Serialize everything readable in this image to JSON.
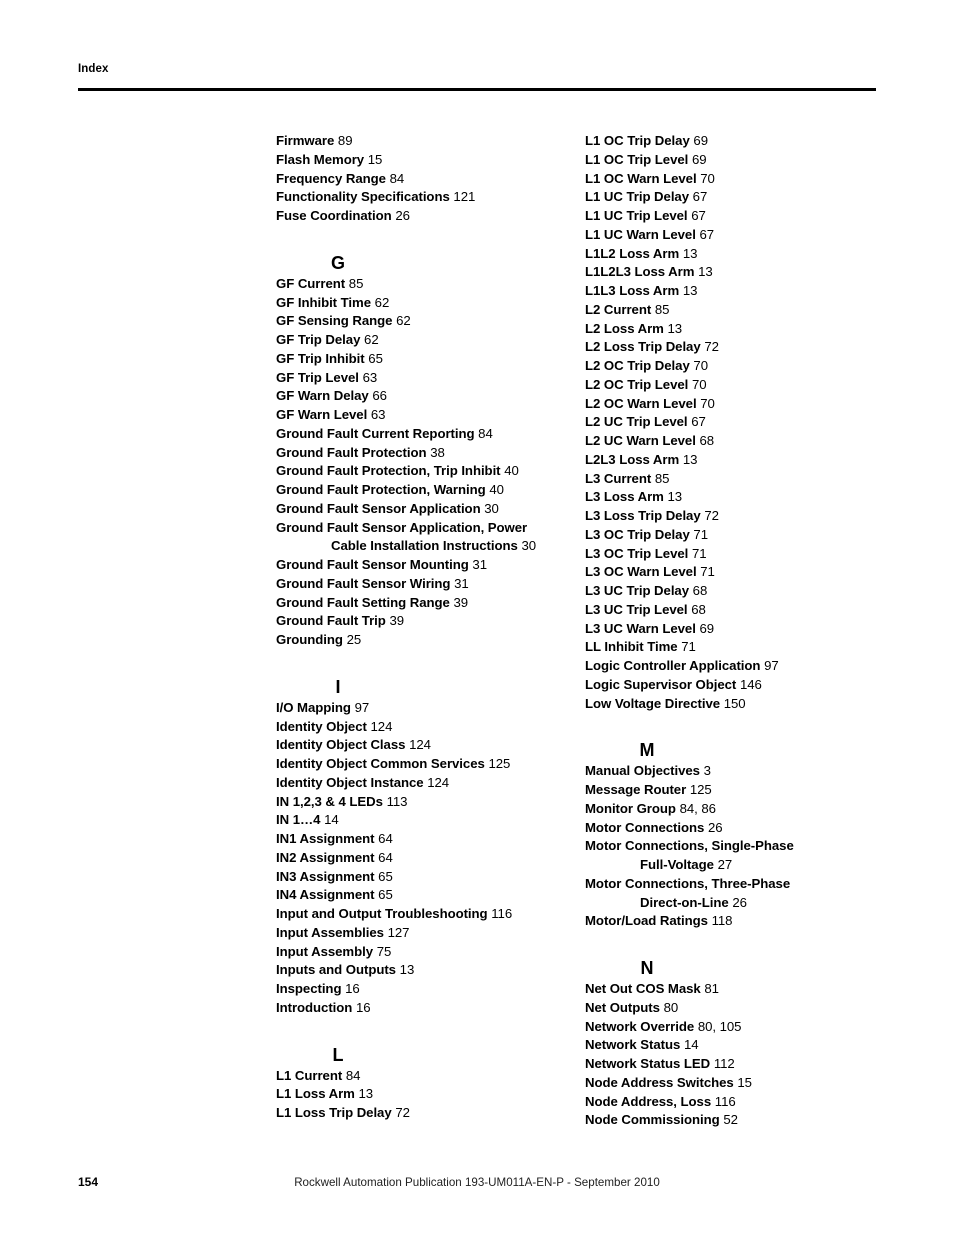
{
  "header": {
    "title": "Index"
  },
  "footer": {
    "page_number": "154",
    "publication": "Rockwell Automation Publication 193-UM011A-EN-P - September 2010"
  },
  "columns": {
    "left": [
      {
        "kind": "entries",
        "entries": [
          {
            "term": "Firmware",
            "pages": "89"
          },
          {
            "term": "Flash Memory",
            "pages": "15"
          },
          {
            "term": "Frequency Range",
            "pages": "84"
          },
          {
            "term": "Functionality Specifications",
            "pages": "121"
          },
          {
            "term": "Fuse Coordination",
            "pages": "26"
          }
        ]
      },
      {
        "kind": "section",
        "letter": "G",
        "entries": [
          {
            "term": "GF Current",
            "pages": "85"
          },
          {
            "term": "GF Inhibit Time",
            "pages": "62"
          },
          {
            "term": "GF Sensing Range",
            "pages": "62"
          },
          {
            "term": "GF Trip Delay",
            "pages": "62"
          },
          {
            "term": "GF Trip Inhibit",
            "pages": "65"
          },
          {
            "term": "GF Trip Level",
            "pages": "63"
          },
          {
            "term": "GF Warn Delay",
            "pages": "66"
          },
          {
            "term": "GF Warn Level",
            "pages": "63"
          },
          {
            "term": "Ground Fault Current Reporting",
            "pages": "84"
          },
          {
            "term": "Ground Fault Protection",
            "pages": "38"
          },
          {
            "term": "Ground Fault Protection, Trip Inhibit",
            "pages": "40"
          },
          {
            "term": "Ground Fault Protection, Warning",
            "pages": "40"
          },
          {
            "term": "Ground Fault Sensor Application",
            "pages": "30"
          },
          {
            "term": "Ground Fault Sensor Application, Power",
            "cont": "Cable Installation Instructions",
            "pages": "30"
          },
          {
            "term": "Ground Fault Sensor Mounting",
            "pages": "31"
          },
          {
            "term": "Ground Fault Sensor Wiring",
            "pages": "31"
          },
          {
            "term": "Ground Fault Setting Range",
            "pages": "39"
          },
          {
            "term": "Ground Fault Trip",
            "pages": "39"
          },
          {
            "term": "Grounding",
            "pages": "25"
          }
        ]
      },
      {
        "kind": "section",
        "letter": "I",
        "entries": [
          {
            "term": "I/O Mapping",
            "pages": "97"
          },
          {
            "term": "Identity Object",
            "pages": "124"
          },
          {
            "term": "Identity Object Class",
            "pages": "124"
          },
          {
            "term": "Identity Object Common Services",
            "pages": "125"
          },
          {
            "term": "Identity Object Instance",
            "pages": "124"
          },
          {
            "term": "IN 1,2,3 & 4 LEDs",
            "pages": "113"
          },
          {
            "term": "IN 1…4",
            "pages": "14"
          },
          {
            "term": "IN1 Assignment",
            "pages": "64"
          },
          {
            "term": "IN2 Assignment",
            "pages": "64"
          },
          {
            "term": "IN3 Assignment",
            "pages": "65"
          },
          {
            "term": "IN4 Assignment",
            "pages": "65"
          },
          {
            "term": "Input and Output Troubleshooting",
            "pages": "116"
          },
          {
            "term": "Input Assemblies",
            "pages": "127"
          },
          {
            "term": "Input Assembly",
            "pages": "75"
          },
          {
            "term": "Inputs and Outputs",
            "pages": "13"
          },
          {
            "term": "Inspecting",
            "pages": "16"
          },
          {
            "term": "Introduction",
            "pages": "16"
          }
        ]
      },
      {
        "kind": "section",
        "letter": "L",
        "entries": [
          {
            "term": "L1 Current",
            "pages": "84"
          },
          {
            "term": "L1 Loss Arm",
            "pages": "13"
          },
          {
            "term": "L1 Loss Trip Delay",
            "pages": "72"
          }
        ]
      }
    ],
    "right": [
      {
        "kind": "entries",
        "entries": [
          {
            "term": "L1 OC Trip Delay",
            "pages": "69"
          },
          {
            "term": "L1 OC Trip Level",
            "pages": "69"
          },
          {
            "term": "L1 OC Warn Level",
            "pages": "70"
          },
          {
            "term": "L1 UC Trip Delay",
            "pages": "67"
          },
          {
            "term": "L1 UC Trip Level",
            "pages": "67"
          },
          {
            "term": "L1 UC Warn Level",
            "pages": "67"
          },
          {
            "term": "L1L2 Loss Arm",
            "pages": "13"
          },
          {
            "term": "L1L2L3 Loss Arm",
            "pages": "13"
          },
          {
            "term": "L1L3 Loss Arm",
            "pages": "13"
          },
          {
            "term": "L2 Current",
            "pages": "85"
          },
          {
            "term": "L2 Loss Arm",
            "pages": "13"
          },
          {
            "term": "L2 Loss Trip Delay",
            "pages": "72"
          },
          {
            "term": "L2 OC Trip Delay",
            "pages": "70"
          },
          {
            "term": "L2 OC Trip Level",
            "pages": "70"
          },
          {
            "term": "L2 OC Warn Level",
            "pages": "70"
          },
          {
            "term": "L2 UC Trip Level",
            "pages": "67"
          },
          {
            "term": "L2 UC Warn Level",
            "pages": "68"
          },
          {
            "term": "L2L3 Loss Arm",
            "pages": "13"
          },
          {
            "term": "L3 Current",
            "pages": "85"
          },
          {
            "term": "L3 Loss Arm",
            "pages": "13"
          },
          {
            "term": "L3 Loss Trip Delay",
            "pages": "72"
          },
          {
            "term": "L3 OC Trip Delay",
            "pages": "71"
          },
          {
            "term": "L3 OC Trip Level",
            "pages": "71"
          },
          {
            "term": "L3 OC Warn Level",
            "pages": "71"
          },
          {
            "term": "L3 UC Trip Delay",
            "pages": "68"
          },
          {
            "term": "L3 UC Trip Level",
            "pages": "68"
          },
          {
            "term": "L3 UC Warn Level",
            "pages": "69"
          },
          {
            "term": "LL Inhibit Time",
            "pages": "71"
          },
          {
            "term": "Logic Controller Application",
            "pages": "97"
          },
          {
            "term": "Logic Supervisor Object",
            "pages": "146"
          },
          {
            "term": "Low Voltage Directive",
            "pages": "150"
          }
        ]
      },
      {
        "kind": "section",
        "letter": "M",
        "entries": [
          {
            "term": "Manual Objectives",
            "pages": "3"
          },
          {
            "term": "Message Router",
            "pages": "125"
          },
          {
            "term": "Monitor Group",
            "pages": "84, 86"
          },
          {
            "term": "Motor Connections",
            "pages": "26"
          },
          {
            "term": "Motor Connections, Single-Phase",
            "cont": "Full-Voltage",
            "pages": "27"
          },
          {
            "term": "Motor Connections, Three-Phase",
            "cont": "Direct-on-Line",
            "pages": "26"
          },
          {
            "term": "Motor/Load Ratings",
            "pages": "118"
          }
        ]
      },
      {
        "kind": "section",
        "letter": "N",
        "entries": [
          {
            "term": "Net Out COS Mask",
            "pages": "81"
          },
          {
            "term": "Net Outputs",
            "pages": "80"
          },
          {
            "term": "Network Override",
            "pages": "80, 105"
          },
          {
            "term": "Network Status",
            "pages": "14"
          },
          {
            "term": "Network Status LED",
            "pages": "112"
          },
          {
            "term": "Node Address Switches",
            "pages": "15"
          },
          {
            "term": "Node Address, Loss",
            "pages": "116"
          },
          {
            "term": "Node Commissioning",
            "pages": "52"
          }
        ]
      }
    ]
  }
}
